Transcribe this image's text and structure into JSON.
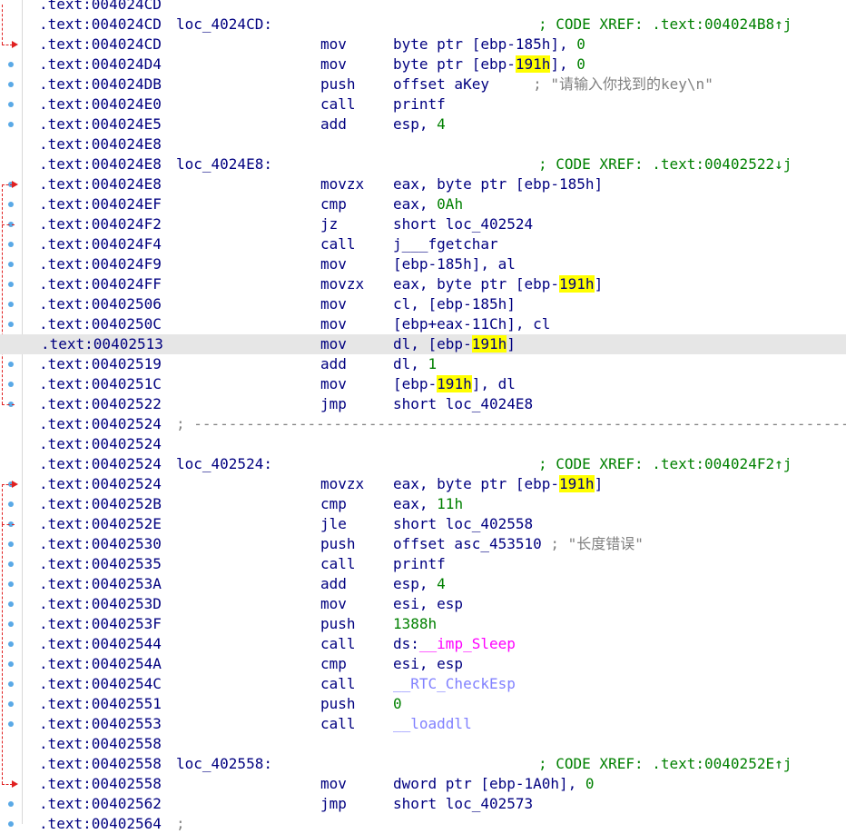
{
  "view": {
    "name": "IDA View-A",
    "segment": ".text",
    "highlight_token": "191h",
    "highlight_color": "#ffff00",
    "current_line_bg": "#e6e6e6",
    "colors": {
      "address": "#000080",
      "instruction": "#000080",
      "number": "#008000",
      "comment": "#808080",
      "xref": "#008000",
      "import": "#ff00ff",
      "library_function": "#8080ff",
      "flow_arrow": "#e02020",
      "gutter_dot": "#5aa9e6"
    }
  },
  "lines": [
    {
      "addr": ".text:004024CD"
    },
    {
      "addr": ".text:004024CD",
      "label": "loc_4024CD:",
      "xref": "; CODE XREF: .text:004024B8↑j"
    },
    {
      "addr": ".text:004024CD",
      "mnem": "mov",
      "ops": [
        {
          "t": "byte ptr [ebp-185h], "
        },
        {
          "t": "0",
          "c": "num"
        }
      ]
    },
    {
      "addr": ".text:004024D4",
      "mnem": "mov",
      "ops": [
        {
          "t": "byte ptr [ebp-"
        },
        {
          "t": "191h",
          "c": "ymark"
        },
        {
          "t": "], "
        },
        {
          "t": "0",
          "c": "num"
        }
      ]
    },
    {
      "addr": ".text:004024DB",
      "mnem": "push",
      "ops": [
        {
          "t": "offset aKey     "
        },
        {
          "t": "; \"请输入你找到的key\\n\"",
          "c": "cmt"
        }
      ]
    },
    {
      "addr": ".text:004024E0",
      "mnem": "call",
      "ops": [
        {
          "t": "printf"
        }
      ]
    },
    {
      "addr": ".text:004024E5",
      "mnem": "add",
      "ops": [
        {
          "t": "esp, "
        },
        {
          "t": "4",
          "c": "num"
        }
      ]
    },
    {
      "addr": ".text:004024E8"
    },
    {
      "addr": ".text:004024E8",
      "label": "loc_4024E8:",
      "xref": "; CODE XREF: .text:00402522↓j"
    },
    {
      "addr": ".text:004024E8",
      "mnem": "movzx",
      "ops": [
        {
          "t": "eax, byte ptr [ebp-185h]"
        }
      ]
    },
    {
      "addr": ".text:004024EF",
      "mnem": "cmp",
      "ops": [
        {
          "t": "eax, "
        },
        {
          "t": "0Ah",
          "c": "num"
        }
      ]
    },
    {
      "addr": ".text:004024F2",
      "mnem": "jz",
      "ops": [
        {
          "t": "short loc_402524"
        }
      ]
    },
    {
      "addr": ".text:004024F4",
      "mnem": "call",
      "ops": [
        {
          "t": "j___fgetchar"
        }
      ]
    },
    {
      "addr": ".text:004024F9",
      "mnem": "mov",
      "ops": [
        {
          "t": "[ebp-185h], al"
        }
      ]
    },
    {
      "addr": ".text:004024FF",
      "mnem": "movzx",
      "ops": [
        {
          "t": "eax, byte ptr [ebp-"
        },
        {
          "t": "191h",
          "c": "ymark"
        },
        {
          "t": "]"
        }
      ]
    },
    {
      "addr": ".text:00402506",
      "mnem": "mov",
      "ops": [
        {
          "t": "cl, [ebp-185h]"
        }
      ]
    },
    {
      "addr": ".text:0040250C",
      "mnem": "mov",
      "ops": [
        {
          "t": "[ebp+eax-11Ch], cl"
        }
      ]
    },
    {
      "addr": ".text:00402513",
      "mnem": "mov",
      "current": true,
      "ops": [
        {
          "t": "dl, [ebp-"
        },
        {
          "t": "191h",
          "c": "ymark"
        },
        {
          "t": "]"
        }
      ]
    },
    {
      "addr": ".text:00402519",
      "mnem": "add",
      "ops": [
        {
          "t": "dl, "
        },
        {
          "t": "1",
          "c": "num"
        }
      ]
    },
    {
      "addr": ".text:0040251C",
      "mnem": "mov",
      "ops": [
        {
          "t": "[ebp-"
        },
        {
          "t": "191h",
          "c": "ymark"
        },
        {
          "t": "], dl"
        }
      ]
    },
    {
      "addr": ".text:00402522",
      "mnem": "jmp",
      "ops": [
        {
          "t": "short loc_4024E8"
        }
      ]
    },
    {
      "addr": ".text:00402524",
      "sep": "; ---------------------------------------------------------------------------"
    },
    {
      "addr": ".text:00402524"
    },
    {
      "addr": ".text:00402524",
      "label": "loc_402524:",
      "xref": "; CODE XREF: .text:004024F2↑j"
    },
    {
      "addr": ".text:00402524",
      "mnem": "movzx",
      "ops": [
        {
          "t": "eax, byte ptr [ebp-"
        },
        {
          "t": "191h",
          "c": "ymark"
        },
        {
          "t": "]"
        }
      ]
    },
    {
      "addr": ".text:0040252B",
      "mnem": "cmp",
      "ops": [
        {
          "t": "eax, "
        },
        {
          "t": "11h",
          "c": "num"
        }
      ]
    },
    {
      "addr": ".text:0040252E",
      "mnem": "jle",
      "ops": [
        {
          "t": "short loc_402558"
        }
      ]
    },
    {
      "addr": ".text:00402530",
      "mnem": "push",
      "ops": [
        {
          "t": "offset asc_453510 "
        },
        {
          "t": "; \"长度错误\"",
          "c": "cmt"
        }
      ]
    },
    {
      "addr": ".text:00402535",
      "mnem": "call",
      "ops": [
        {
          "t": "printf"
        }
      ]
    },
    {
      "addr": ".text:0040253A",
      "mnem": "add",
      "ops": [
        {
          "t": "esp, "
        },
        {
          "t": "4",
          "c": "num"
        }
      ]
    },
    {
      "addr": ".text:0040253D",
      "mnem": "mov",
      "ops": [
        {
          "t": "esi, esp"
        }
      ]
    },
    {
      "addr": ".text:0040253F",
      "mnem": "push",
      "ops": [
        {
          "t": "1388h",
          "c": "num"
        }
      ]
    },
    {
      "addr": ".text:00402544",
      "mnem": "call",
      "ops": [
        {
          "t": "ds:"
        },
        {
          "t": "__imp_Sleep",
          "c": "imp"
        }
      ]
    },
    {
      "addr": ".text:0040254A",
      "mnem": "cmp",
      "ops": [
        {
          "t": "esi, esp"
        }
      ]
    },
    {
      "addr": ".text:0040254C",
      "mnem": "call",
      "ops": [
        {
          "t": "__RTC_CheckEsp",
          "c": "lib"
        }
      ]
    },
    {
      "addr": ".text:00402551",
      "mnem": "push",
      "ops": [
        {
          "t": "0",
          "c": "num"
        }
      ]
    },
    {
      "addr": ".text:00402553",
      "mnem": "call",
      "ops": [
        {
          "t": "__loaddll",
          "c": "lib"
        }
      ]
    },
    {
      "addr": ".text:00402558"
    },
    {
      "addr": ".text:00402558",
      "label": "loc_402558:",
      "xref": "; CODE XREF: .text:0040252E↑j"
    },
    {
      "addr": ".text:00402558",
      "mnem": "mov",
      "ops": [
        {
          "t": "dword ptr [ebp-1A0h], "
        },
        {
          "t": "0",
          "c": "num"
        }
      ]
    },
    {
      "addr": ".text:00402562",
      "mnem": "jmp",
      "ops": [
        {
          "t": "short loc_402573"
        }
      ]
    },
    {
      "addr": ".text:00402564",
      "sep": ";"
    }
  ]
}
